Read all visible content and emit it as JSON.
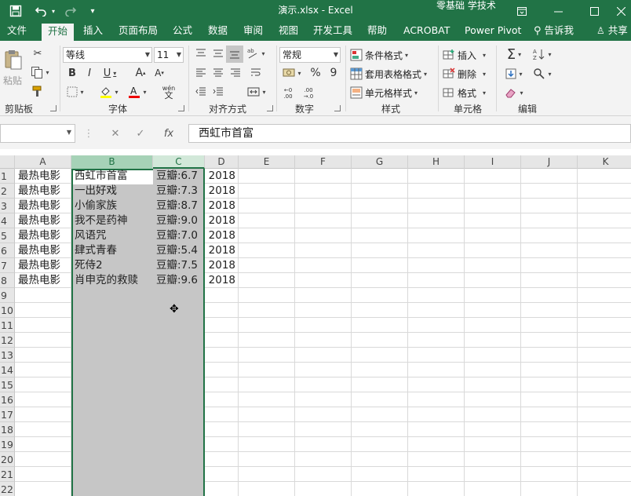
{
  "titlebar": {
    "title": "演示.xlsx  -  Excel",
    "account": "零基础 学技术",
    "icons": [
      "save-icon",
      "undo-icon",
      "redo-icon",
      "customize-icon"
    ],
    "win_buttons": [
      "ribbon-display-icon",
      "minimize-icon",
      "maximize-icon",
      "close-icon"
    ]
  },
  "tabs": [
    {
      "label": "文件"
    },
    {
      "label": "开始"
    },
    {
      "label": "插入"
    },
    {
      "label": "页面布局"
    },
    {
      "label": "公式"
    },
    {
      "label": "数据"
    },
    {
      "label": "审阅"
    },
    {
      "label": "视图"
    },
    {
      "label": "开发工具"
    },
    {
      "label": "帮助"
    },
    {
      "label": "ACROBAT"
    },
    {
      "label": "Power Pivot"
    }
  ],
  "tell_me": "告诉我",
  "share": "共享",
  "ribbon": {
    "clipboard": {
      "paste": "粘贴",
      "label": "剪贴板"
    },
    "font": {
      "name": "等线",
      "size": "11",
      "label": "字体",
      "wen": "wén",
      "wen2": "文"
    },
    "alignment": {
      "label": "对齐方式"
    },
    "number": {
      "format": "常规",
      "label": "数字",
      "percent": "%",
      "comma": "9"
    },
    "styles": {
      "conditional": "条件格式",
      "table": "套用表格格式",
      "cell": "单元格样式",
      "label": "样式"
    },
    "cells": {
      "insert": "插入",
      "delete": "删除",
      "format": "格式",
      "label": "单元格"
    },
    "editing": {
      "label": "编辑"
    }
  },
  "formula_bar": {
    "name_box": "",
    "fx": "fx",
    "cancel": "✕",
    "enter": "✓",
    "value": "西虹市首富"
  },
  "grid": {
    "columns": [
      "A",
      "B",
      "C",
      "D",
      "E",
      "F",
      "G",
      "H",
      "I",
      "J",
      "K"
    ],
    "rows": [
      "1",
      "2",
      "3",
      "4",
      "5",
      "6",
      "7",
      "8",
      "9",
      "10",
      "11",
      "12",
      "13",
      "14",
      "15",
      "16",
      "17",
      "18",
      "19",
      "20",
      "21",
      "22"
    ],
    "data": [
      [
        "最热电影",
        "西虹市首富",
        "豆瓣:6.7",
        "2018"
      ],
      [
        "最热电影",
        "一出好戏",
        "豆瓣:7.3",
        "2018"
      ],
      [
        "最热电影",
        "小偷家族",
        "豆瓣:8.7",
        "2018"
      ],
      [
        "最热电影",
        "我不是药神",
        "豆瓣:9.0",
        "2018"
      ],
      [
        "最热电影",
        "风语咒",
        "豆瓣:7.0",
        "2018"
      ],
      [
        "最热电影",
        "肆式青春",
        "豆瓣:5.4",
        "2018"
      ],
      [
        "最热电影",
        "死侍2",
        "豆瓣:7.5",
        "2018"
      ],
      [
        "最热电影",
        "肖申克的救赎",
        "豆瓣:9.6",
        "2018"
      ]
    ]
  }
}
